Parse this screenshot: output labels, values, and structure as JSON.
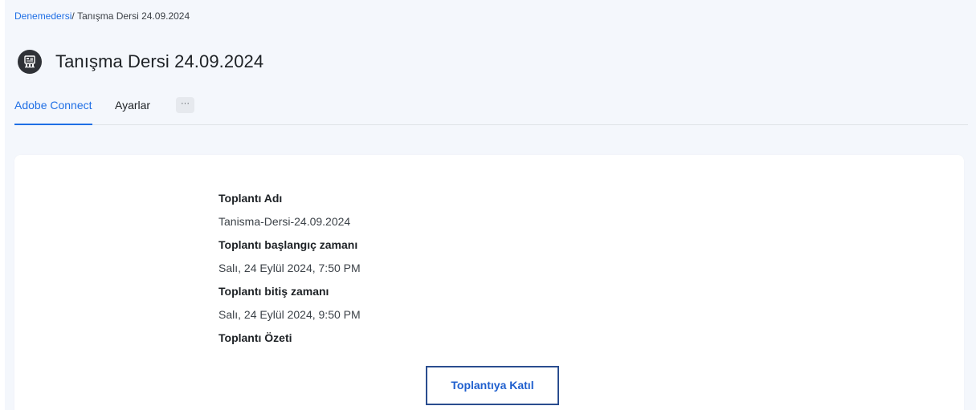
{
  "breadcrumb": {
    "course": "Denemedersi",
    "separator": "/",
    "current": "Tanışma Dersi 24.09.2024"
  },
  "header": {
    "icon": "adobe-connect-icon",
    "title": "Tanışma Dersi 24.09.2024"
  },
  "tabs": [
    {
      "label": "Adobe Connect",
      "active": true
    },
    {
      "label": "Ayarlar",
      "active": false
    }
  ],
  "more_tab": {
    "label": "···"
  },
  "meeting": {
    "name_label": "Toplantı Adı",
    "name_value": "Tanisma-Dersi-24.09.2024",
    "start_label": "Toplantı başlangıç zamanı",
    "start_value": "Salı, 24 Eylül 2024, 7:50 PM",
    "end_label": "Toplantı bitiş zamanı",
    "end_value": "Salı, 24 Eylül 2024, 9:50 PM",
    "summary_label": "Toplantı Özeti",
    "join_button": "Toplantıya Katıl"
  },
  "colors": {
    "accent": "#1f6fe5",
    "page_background": "#f4f7fc",
    "button_border": "#2a4d8f"
  }
}
